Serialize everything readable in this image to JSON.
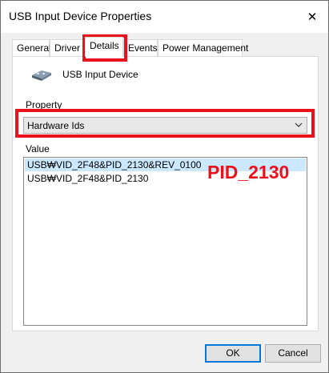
{
  "window": {
    "title": "USB Input Device Properties",
    "close_glyph": "✕"
  },
  "tabs": [
    {
      "label": "General"
    },
    {
      "label": "Driver"
    },
    {
      "label": "Details"
    },
    {
      "label": "Events"
    },
    {
      "label": "Power Management"
    }
  ],
  "details": {
    "device_name": "USB Input Device",
    "property_label": "Property",
    "property_selected": "Hardware Ids",
    "value_label": "Value",
    "values": [
      "USB₩VID_2F48&PID_2130&REV_0100",
      "USB₩VID_2F48&PID_2130"
    ]
  },
  "annotation": {
    "text": "PID_2130",
    "color": "#e8121c"
  },
  "buttons": {
    "ok": "OK",
    "cancel": "Cancel"
  },
  "colors": {
    "selection": "#cce8ff",
    "highlight": "#e8121c",
    "accent": "#0078d7"
  }
}
